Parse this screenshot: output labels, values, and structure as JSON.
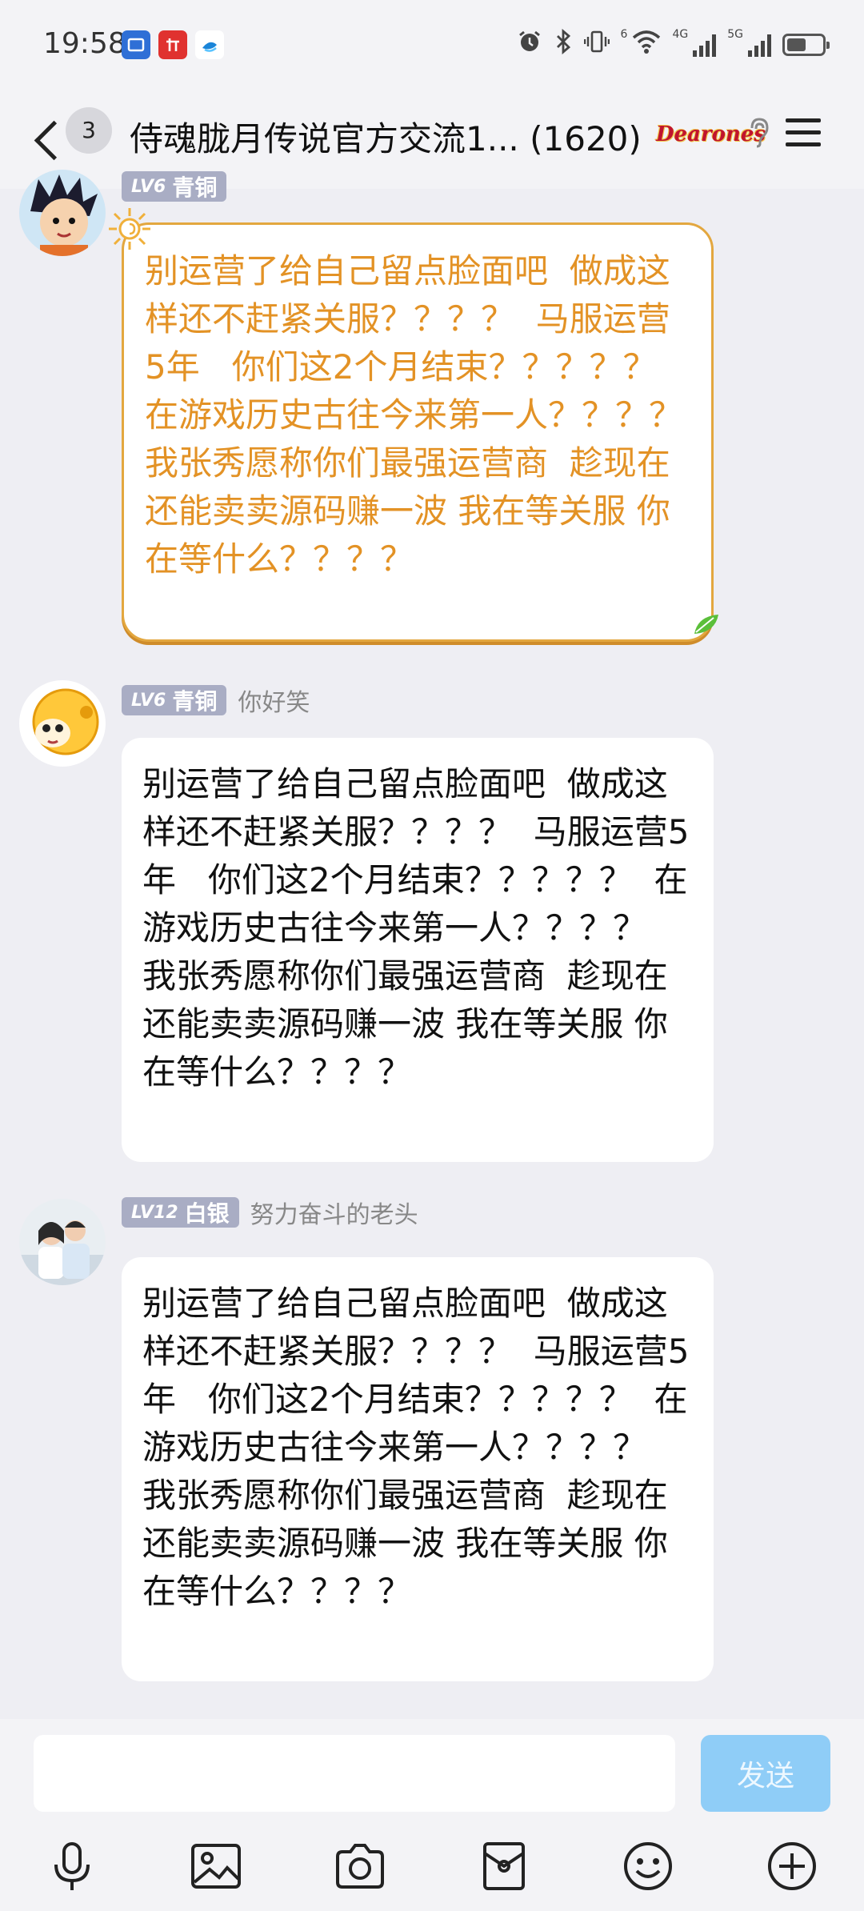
{
  "status_bar": {
    "time": "19:58",
    "app_icons": [
      "app-badge-icon",
      "taobao-icon",
      "cloud-app-icon"
    ],
    "network_label_wifi": "6",
    "network_label_cell": "4G",
    "network_label_cell2": "5G",
    "battery_level": 0.55
  },
  "header": {
    "back_label": "back",
    "unread_count": "3",
    "title": "侍魂胧月传说官方交流1... (1620)",
    "brand_logo_text": "Dearones"
  },
  "messages": [
    {
      "level": "LV6",
      "rank": "青铜",
      "nickname": "",
      "text": "别运营了给自己留点脸面吧  做成这样还不赶紧关服？？？？  马服运营5年   你们这2个月结束？？？？？  在游戏历史古往今来第一人？？？？  我张秀愿称你们最强运营商  趁现在还能卖卖源码赚一波 我在等关服 你在等什么？？？？"
    },
    {
      "level": "LV6",
      "rank": "青铜",
      "nickname": "你好笑",
      "text": "别运营了给自己留点脸面吧  做成这样还不赶紧关服？？？？  马服运营5年   你们这2个月结束？？？？？  在游戏历史古往今来第一人？？？？  我张秀愿称你们最强运营商  趁现在还能卖卖源码赚一波 我在等关服 你在等什么？？？？"
    },
    {
      "level": "LV12",
      "rank": "白银",
      "nickname": "努力奋斗的老头",
      "text": "别运营了给自己留点脸面吧  做成这样还不赶紧关服？？？？  马服运营5年   你们这2个月结束？？？？？  在游戏历史古往今来第一人？？？？  我张秀愿称你们最强运营商  趁现在还能卖卖源码赚一波 我在等关服 你在等什么？？？？"
    }
  ],
  "composer": {
    "input_value": "",
    "input_placeholder": "",
    "send_label": "发送"
  },
  "toolbar": {
    "icons": [
      "microphone-icon",
      "image-icon",
      "camera-icon",
      "red-packet-icon",
      "emoji-icon",
      "plus-icon"
    ]
  },
  "colors": {
    "accent": "#8fcdf7",
    "fancy_bubble_border": "#e3a73f",
    "fancy_bubble_text": "#e39225",
    "level_badge": "#a9adc4"
  }
}
